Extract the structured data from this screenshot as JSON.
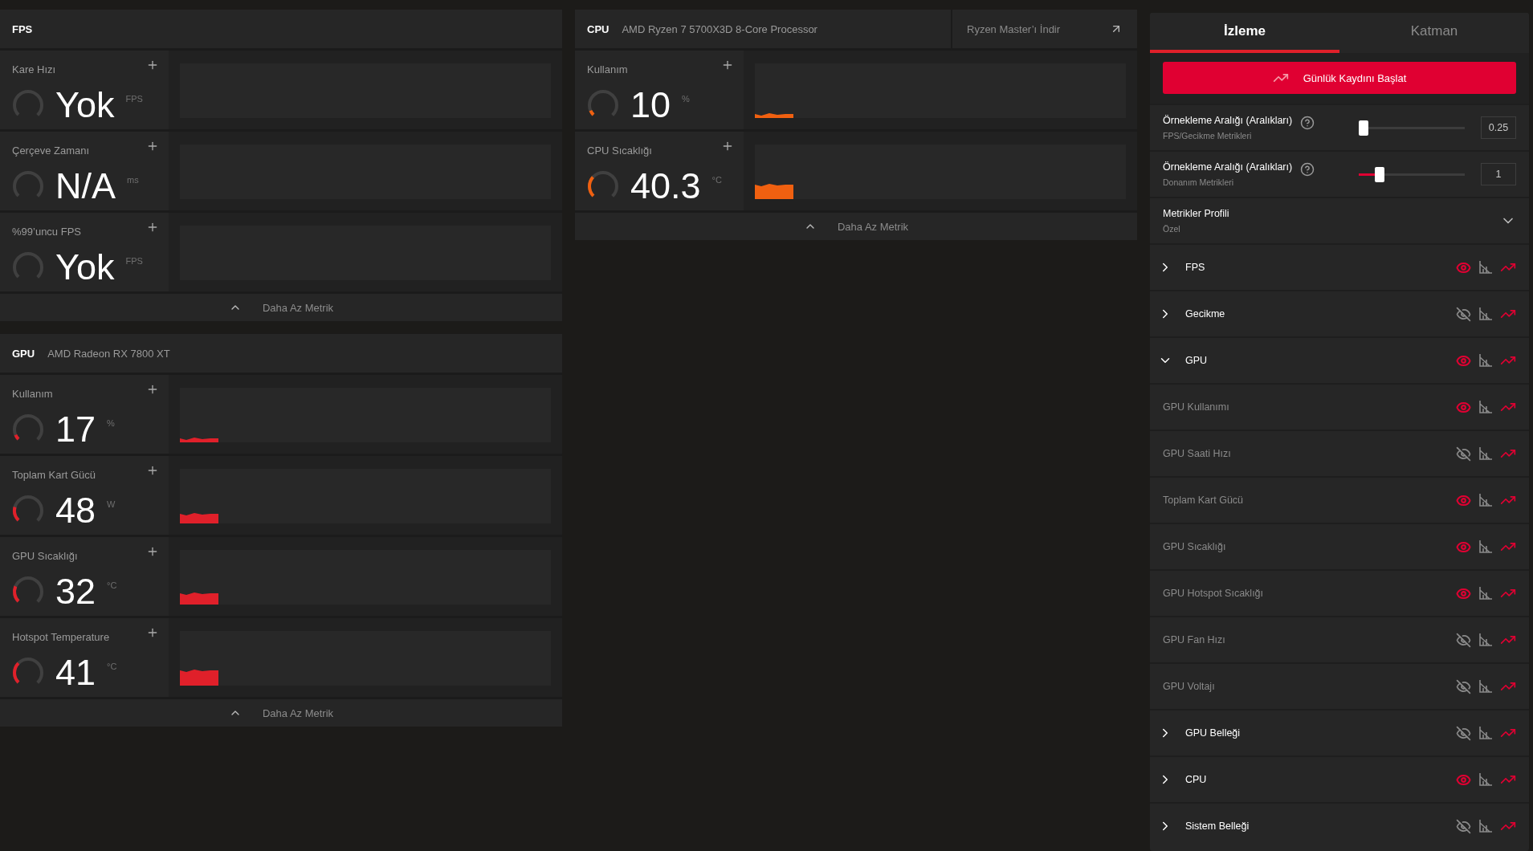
{
  "panels": [
    {
      "title": "FPS",
      "footer": "Daha Az Metrik",
      "metrics": [
        {
          "label": "Kare Hızı",
          "value": "Yok",
          "unit": "FPS"
        },
        {
          "label": "Çerçeve Zamanı",
          "value": "N/A",
          "unit": "ms"
        },
        {
          "label": "%99’uncu FPS",
          "value": "Yok",
          "unit": "FPS"
        }
      ]
    },
    {
      "title": "GPU",
      "device": "AMD Radeon RX 7800 XT",
      "color": "#e0202a",
      "footer": "Daha Az Metrik",
      "metrics": [
        {
          "label": "Kullanım",
          "value": "17",
          "unit": "%",
          "level": 0.08
        },
        {
          "label": "Toplam Kart Gücü",
          "value": "48",
          "unit": "W",
          "level": 0.22
        },
        {
          "label": "GPU Sıcaklığı",
          "value": "32",
          "unit": "°C",
          "level": 0.25
        },
        {
          "label": "Hotspot Temperature",
          "value": "41",
          "unit": "°C",
          "level": 0.33
        }
      ]
    },
    {
      "title": "CPU",
      "device": "AMD Ryzen 7 5700X3D 8-Core Processor",
      "link": "Ryzen Master’ı İndir",
      "color": "#f06010",
      "footer": "Daha Az Metrik",
      "metrics": [
        {
          "label": "Kullanım",
          "value": "10",
          "unit": "%",
          "level": 0.08
        },
        {
          "label": "CPU Sıcaklığı",
          "value": "40.3",
          "unit": "°C",
          "level": 0.32
        }
      ]
    }
  ],
  "side": {
    "tabs": [
      {
        "label": "İzleme",
        "selected": true
      },
      {
        "label": "Katman",
        "selected": false
      }
    ],
    "start_button": "Günlük Kaydını Başlat",
    "sliders": [
      {
        "label": "Örnekleme Aralığı (Aralıkları)",
        "sublabel": "FPS/Gecikme Metrikleri",
        "level": 0,
        "value": "0.25"
      },
      {
        "label": "Örnekleme Aralığı (Aralıkları)",
        "sublabel": "Donanım Metrikleri",
        "level": 0.2,
        "value": "1"
      }
    ],
    "profile": {
      "label": "Metrikler Profili",
      "value": "Özel"
    },
    "tree": [
      {
        "label": "FPS",
        "expanded": false,
        "visible": true
      },
      {
        "label": "Gecikme",
        "expanded": false,
        "visible": false
      },
      {
        "label": "GPU",
        "expanded": true,
        "visible": true,
        "children": [
          {
            "label": "GPU Kullanımı",
            "visible": true
          },
          {
            "label": "GPU Saati Hızı",
            "visible": false
          },
          {
            "label": "Toplam Kart Gücü",
            "visible": true
          },
          {
            "label": "GPU Sıcaklığı",
            "visible": true
          },
          {
            "label": "GPU Hotspot Sıcaklığı",
            "visible": true
          },
          {
            "label": "GPU Fan Hızı",
            "visible": false
          },
          {
            "label": "GPU Voltajı",
            "visible": false
          }
        ]
      },
      {
        "label": "GPU Belleği",
        "expanded": false,
        "visible": false
      },
      {
        "label": "CPU",
        "expanded": false,
        "visible": true
      },
      {
        "label": "Sistem Belleği",
        "expanded": false,
        "visible": false
      }
    ]
  }
}
